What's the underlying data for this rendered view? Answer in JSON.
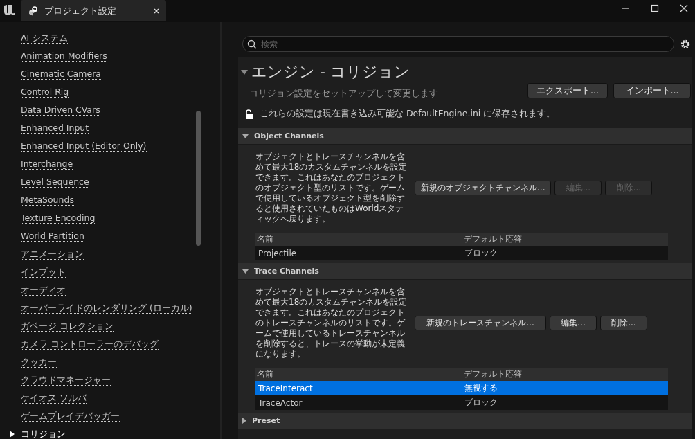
{
  "window": {
    "tab_title": "プロジェクト設定"
  },
  "sidebar": {
    "items": [
      {
        "label": "AI システム",
        "selected": false
      },
      {
        "label": "Animation Modifiers",
        "selected": false
      },
      {
        "label": "Cinematic Camera",
        "selected": false
      },
      {
        "label": "Control Rig",
        "selected": false
      },
      {
        "label": "Data Driven CVars",
        "selected": false
      },
      {
        "label": "Enhanced Input",
        "selected": false
      },
      {
        "label": "Enhanced Input (Editor Only)",
        "selected": false
      },
      {
        "label": "Interchange",
        "selected": false
      },
      {
        "label": "Level Sequence",
        "selected": false
      },
      {
        "label": "MetaSounds",
        "selected": false
      },
      {
        "label": "Texture Encoding",
        "selected": false
      },
      {
        "label": "World Partition",
        "selected": false
      },
      {
        "label": "アニメーション",
        "selected": false
      },
      {
        "label": "インプット",
        "selected": false
      },
      {
        "label": "オーディオ",
        "selected": false
      },
      {
        "label": "オーバーライドのレンダリング (ローカル)",
        "selected": false
      },
      {
        "label": "ガベージ コレクション",
        "selected": false
      },
      {
        "label": "カメラ コントローラーのデバッグ",
        "selected": false
      },
      {
        "label": "クッカー",
        "selected": false
      },
      {
        "label": "クラウドマネージャー",
        "selected": false
      },
      {
        "label": "ケイオス ソルバ",
        "selected": false
      },
      {
        "label": "ゲームプレイデバッガー",
        "selected": false
      },
      {
        "label": "コリジョン",
        "selected": true
      }
    ]
  },
  "search": {
    "placeholder": "検索"
  },
  "page": {
    "title": "エンジン - コリジョン",
    "subtitle": "コリジョン設定をセットアップして変更します",
    "buttons": [
      "エクスポート...",
      "インポート..."
    ],
    "notice": "これらの設定は現在書き込み可能な DefaultEngine.ini に保存されます。"
  },
  "sections": [
    {
      "title": "Object Channels",
      "expanded": true,
      "description": "オブジェクトとトレースチャンネルを含めて最大18のカスタムチャンネルを設定できます。これはあなたのプロジェクトのオブジェクト型のリストです。ゲームで使用しているオブジェクト型を削除すると使用されていたものはWorldスタティックへ戻ります。",
      "buttons": [
        {
          "label": "新規のオブジェクトチャンネル...",
          "disabled": false
        },
        {
          "label": "編集...",
          "disabled": true
        },
        {
          "label": "削除...",
          "disabled": true
        }
      ],
      "columns": [
        "名前",
        "デフォルト応答"
      ],
      "rows": [
        {
          "cells": [
            "Projectile",
            "ブロック"
          ],
          "selected": false
        }
      ]
    },
    {
      "title": "Trace Channels",
      "expanded": true,
      "description": "オブジェクトとトレースチャンネルを含めて最大18のカスタムチャンネルを設定できます。これはあなたのプロジェクトのトレースチャンネルのリストです。ゲームで使用しているトレースチャンネルを削除すると、トレースの挙動が未定義になります。",
      "buttons": [
        {
          "label": "新規のトレースチャンネル...",
          "disabled": false
        },
        {
          "label": "編集...",
          "disabled": false
        },
        {
          "label": "削除...",
          "disabled": false
        }
      ],
      "columns": [
        "名前",
        "デフォルト応答"
      ],
      "rows": [
        {
          "cells": [
            "TraceInteract",
            "無視する"
          ],
          "selected": true
        },
        {
          "cells": [
            "TraceActor",
            "ブロック"
          ],
          "selected": false
        }
      ]
    },
    {
      "title": "Preset",
      "expanded": false
    }
  ]
}
